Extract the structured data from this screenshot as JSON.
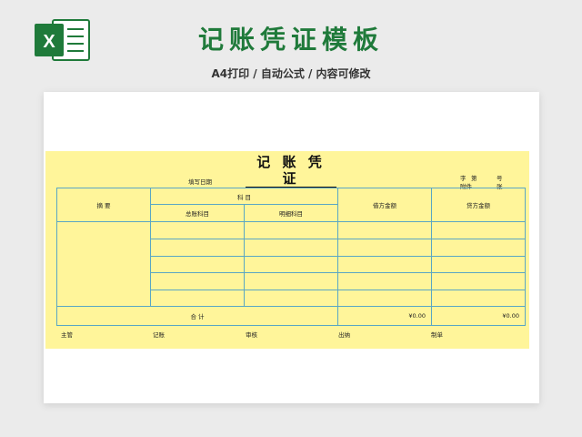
{
  "banner": {
    "title": "记账凭证模板",
    "subtitle": "A4打印 / 自动公式 / 内容可修改",
    "logo_letter": "X",
    "accent_color": "#1f7a3a"
  },
  "voucher": {
    "title": "记 账 凭 证",
    "fill_date_label": "填写日期",
    "zi_label": "字",
    "di_label": "第",
    "hao_label": "号",
    "attach_label": "附件",
    "zhang_label": "张",
    "headers": {
      "summary": "摘    要",
      "subject": "科    目",
      "general_ledger": "总账科目",
      "detail_ledger": "明细科目",
      "debit": "借方金额",
      "credit": "贷方金额"
    },
    "total": {
      "label": "合    计",
      "debit": "¥0.00",
      "credit": "¥0.00"
    },
    "signatures": [
      "主管",
      "记账",
      "审核",
      "出纳",
      "制单"
    ],
    "background_color": "#fff59a",
    "line_color": "#5aa6c4"
  }
}
